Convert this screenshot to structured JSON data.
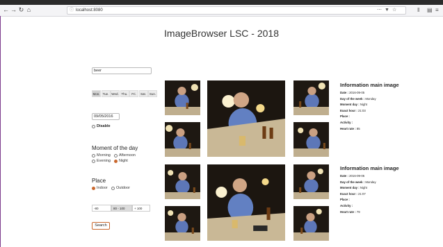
{
  "browser": {
    "url": "localhost:8080"
  },
  "page": {
    "title": "ImageBrowser LSC - 2018"
  },
  "search": {
    "query": "beer"
  },
  "days": [
    "Mon.",
    "Tue.",
    "Wed.",
    "Thu.",
    "Fri.",
    "Sat.",
    "Sun."
  ],
  "date": {
    "value": "09/05/2016",
    "disable_label": "Disable"
  },
  "moment": {
    "title": "Moment of the day",
    "options": [
      "Morning",
      "Afternoon",
      "Evening",
      "Night"
    ],
    "selected": "Night"
  },
  "place": {
    "title": "Place",
    "options": [
      "Indoor",
      "Outdoor"
    ],
    "selected": "Indoor"
  },
  "heart_rate_slider": {
    "low": "-80",
    "mid": "80 - 100",
    "high": "+ 100"
  },
  "search_button": "Search",
  "info_blocks": [
    {
      "title": "Information main image",
      "rows": [
        {
          "label": "Date :",
          "value": "2016-09-05"
        },
        {
          "label": "Day of the week :",
          "value": "Monday"
        },
        {
          "label": "Moment day :",
          "value": "Night"
        },
        {
          "label": "Exact hour :",
          "value": "21:03"
        },
        {
          "label": "Place :",
          "value": ""
        },
        {
          "label": "Activity :",
          "value": ""
        },
        {
          "label": "Heart rate :",
          "value": "85"
        }
      ]
    },
    {
      "title": "Information main image",
      "rows": [
        {
          "label": "Date :",
          "value": "2016-09-05"
        },
        {
          "label": "Day of the week :",
          "value": "Monday"
        },
        {
          "label": "Moment day :",
          "value": "Night"
        },
        {
          "label": "Exact hour :",
          "value": "21:07"
        },
        {
          "label": "Place :",
          "value": ""
        },
        {
          "label": "Activity :",
          "value": ""
        },
        {
          "label": "Heart rate :",
          "value": "79"
        }
      ]
    }
  ],
  "colors": {
    "accent": "#c9672d",
    "photo_dark": "#1a1410"
  }
}
